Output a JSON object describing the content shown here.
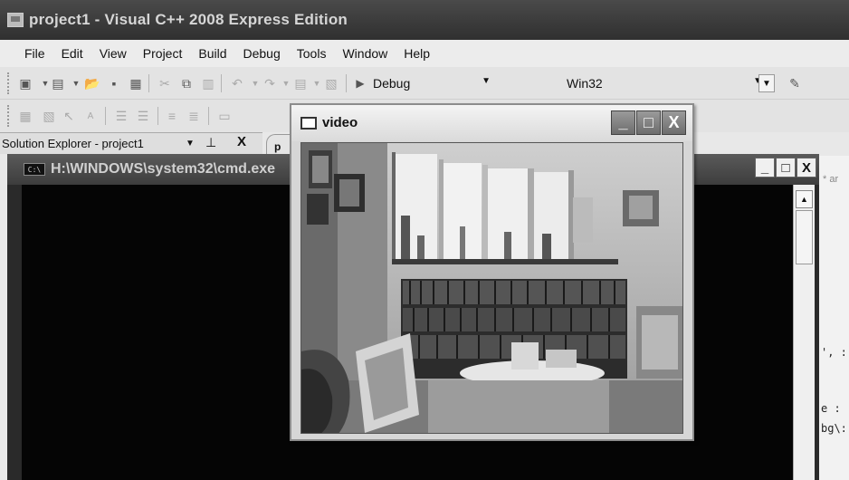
{
  "ide": {
    "title": "project1 - Visual C++ 2008 Express Edition",
    "menu": [
      "File",
      "Edit",
      "View",
      "Project",
      "Build",
      "Debug",
      "Tools",
      "Window",
      "Help"
    ],
    "toolbar": {
      "config_label": "Debug",
      "platform_label": "Win32"
    },
    "solution_explorer": {
      "label": "Solution Explorer - project1",
      "pin_icon": "pin-icon",
      "close_label": "X"
    },
    "editor_tab_label": "p",
    "editor_hint": "* ar",
    "code_fragments": [
      "', :",
      "e :",
      "bg\\:"
    ]
  },
  "cmd_window": {
    "title": "H:\\WINDOWS\\system32\\cmd.exe",
    "icon_label": "C:\\",
    "minimize_label": "_",
    "maximize_label": "□",
    "close_label": "X"
  },
  "video_window": {
    "title": "video",
    "minimize_label": "_",
    "maximize_label": "□",
    "close_label": "X"
  },
  "colors": {
    "titlebar": "#3a3a3a",
    "cmd_background": "#050505",
    "video_chrome": "#d6d6d6"
  }
}
